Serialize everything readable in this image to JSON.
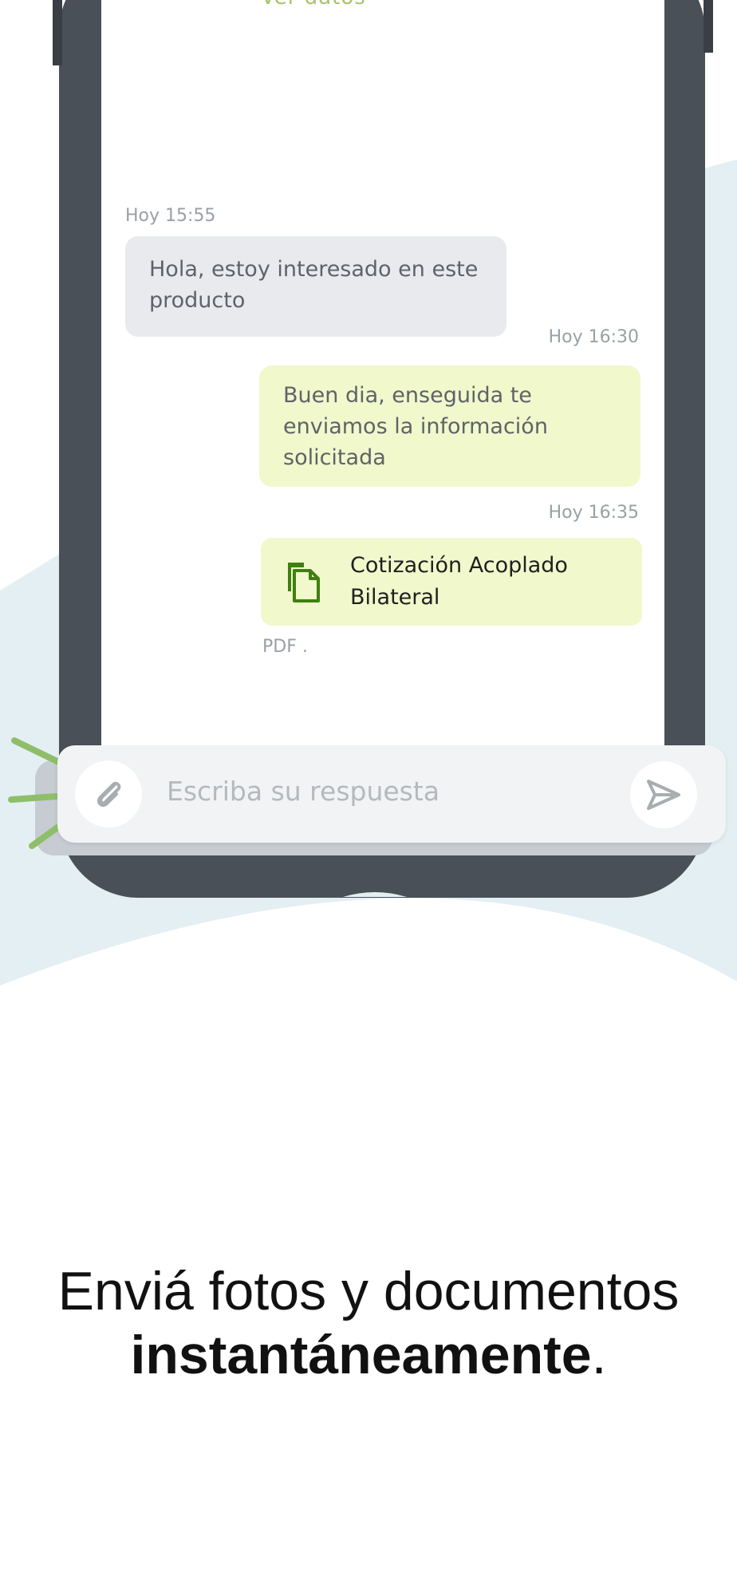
{
  "chat": {
    "faded_top_text": "Ver datos",
    "messages": [
      {
        "time": "Hoy 15:55",
        "text": "Hola, estoy interesado en este producto"
      },
      {
        "time": "Hoy 16:30",
        "text": "Buen dia, enseguida te enviamos la información solicitada"
      }
    ],
    "document": {
      "time": "Hoy 16:35",
      "title": "Cotización Acoplado Bilateral",
      "type_label": "PDF ."
    }
  },
  "input": {
    "placeholder": "Escriba su respuesta"
  },
  "caption": {
    "line1": "Enviá fotos y documentos",
    "line2_bold": "instantáneamente",
    "line2_end": "."
  },
  "colors": {
    "phone": "#4a5058",
    "accent_green": "#3f7f10",
    "bubble_out": "#f1f8cc",
    "bubble_in": "#e8eaed",
    "bg_wave": "#e4eff3"
  },
  "icons": {
    "attach": "paperclip-icon",
    "send": "send-icon",
    "document": "document-icon"
  }
}
